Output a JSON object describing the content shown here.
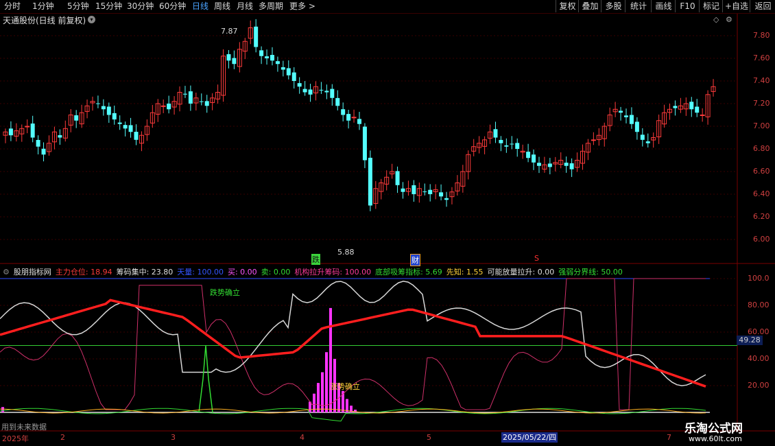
{
  "toolbar": {
    "periods": [
      "分时",
      "1分钟",
      "5分钟",
      "15分钟",
      "30分钟",
      "60分钟",
      "日线",
      "周线",
      "月线",
      "多周期",
      "更多 >"
    ],
    "active_period": "日线",
    "right_buttons": [
      "复权",
      "叠加",
      "多股",
      "统计",
      "画线",
      "F10",
      "标记",
      "+自选",
      "返回"
    ]
  },
  "chart_title": "天通股份(日线 前复权)",
  "price_axis": [
    "7.80",
    "7.60",
    "7.40",
    "7.20",
    "7.00",
    "6.80",
    "6.60",
    "6.40",
    "6.20",
    "6.00"
  ],
  "annotations": {
    "high": "7.87",
    "low": "5.88",
    "die": "跌",
    "cai": "财",
    "s": "S",
    "die_confirm": "跌势确立",
    "zhang_confirm": "涨势确立"
  },
  "indicator": {
    "name": "股朋指标网",
    "fields": [
      {
        "label": "主力仓位: 18.94",
        "color": "#ff3b3b"
      },
      {
        "label": "筹码集中: 23.80",
        "color": "#e0e0e0"
      },
      {
        "label": "天量: 100.00",
        "color": "#3355ff"
      },
      {
        "label": "买: 0.00",
        "color": "#ff55ff"
      },
      {
        "label": "卖: 0.00",
        "color": "#33dd33"
      },
      {
        "label": "机构拉升筹码: 100.00",
        "color": "#ff3b9b"
      },
      {
        "label": "底部吸筹指标: 5.69",
        "color": "#33dd33"
      },
      {
        "label": "先知: 1.55",
        "color": "#ffd23a"
      },
      {
        "label": "可能放量拉升: 0.00",
        "color": "#e0e0e0"
      },
      {
        "label": "强弱分界线: 50.00",
        "color": "#33dd33"
      }
    ]
  },
  "indicator_axis": [
    "100.0",
    "80.00",
    "60.00",
    "40.00",
    "20.00"
  ],
  "current_value": "49.28",
  "x_axis": [
    "2025年",
    "2",
    "3",
    "4",
    "5",
    "2025/05/22/四",
    "7"
  ],
  "future_label": "用到未来数据",
  "watermark": {
    "title": "乐淘公式网",
    "url": "www.60lt.com"
  }
}
